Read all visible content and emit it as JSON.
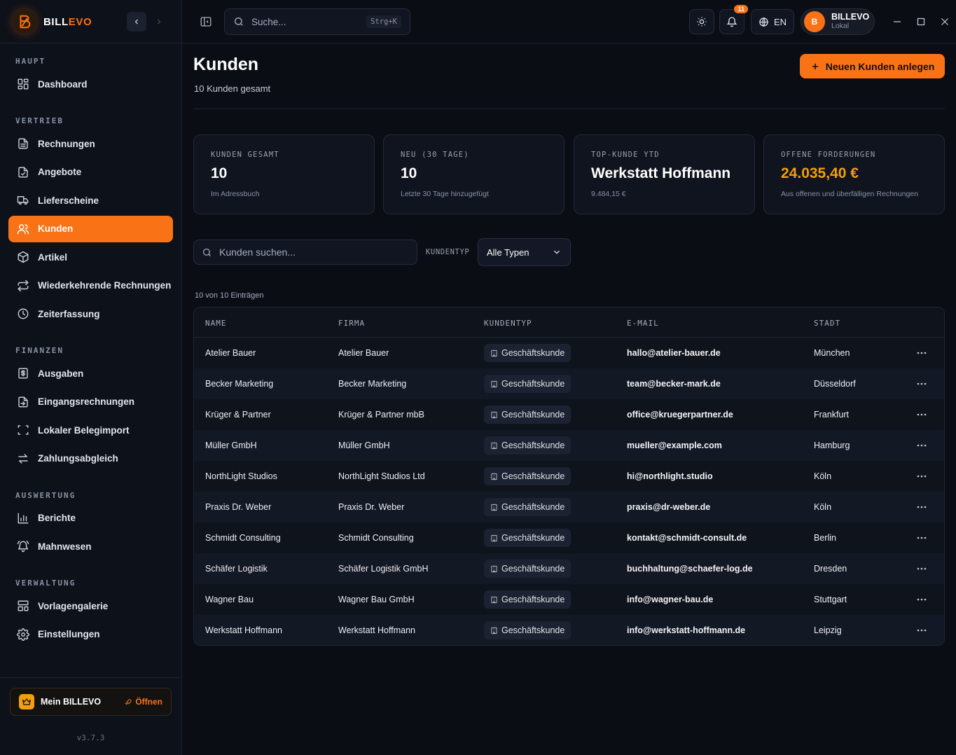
{
  "app": {
    "brand_prefix": "BILL",
    "brand_suffix": "EVO",
    "version": "v3.7.3",
    "accent_color": "#f97316"
  },
  "sidebar": {
    "sections": [
      {
        "label": "HAUPT",
        "items": [
          {
            "label": "Dashboard",
            "icon": "dashboard-icon"
          }
        ]
      },
      {
        "label": "VERTRIEB",
        "items": [
          {
            "label": "Rechnungen",
            "icon": "invoice-icon"
          },
          {
            "label": "Angebote",
            "icon": "quote-icon"
          },
          {
            "label": "Lieferscheine",
            "icon": "truck-icon"
          },
          {
            "label": "Kunden",
            "icon": "users-icon",
            "active": true
          },
          {
            "label": "Artikel",
            "icon": "package-icon"
          },
          {
            "label": "Wiederkehrende Rechnungen",
            "icon": "repeat-icon"
          },
          {
            "label": "Zeiterfassung",
            "icon": "clock-icon"
          }
        ]
      },
      {
        "label": "FINANZEN",
        "items": [
          {
            "label": "Ausgaben",
            "icon": "expense-icon"
          },
          {
            "label": "Eingangsrechnungen",
            "icon": "incoming-invoice-icon"
          },
          {
            "label": "Lokaler Belegimport",
            "icon": "scan-icon"
          },
          {
            "label": "Zahlungsabgleich",
            "icon": "swap-icon"
          }
        ]
      },
      {
        "label": "AUSWERTUNG",
        "items": [
          {
            "label": "Berichte",
            "icon": "bar-chart-icon"
          },
          {
            "label": "Mahnwesen",
            "icon": "bell-ring-icon"
          }
        ]
      },
      {
        "label": "VERWALTUNG",
        "items": [
          {
            "label": "Vorlagengalerie",
            "icon": "template-icon"
          },
          {
            "label": "Einstellungen",
            "icon": "gear-icon"
          }
        ]
      }
    ],
    "promo": {
      "label": "Mein BILLEVO",
      "action": "Öffnen"
    }
  },
  "topbar": {
    "search_placeholder": "Suche...",
    "search_shortcut": "Strg+K",
    "notifications_count": "11",
    "language": "EN",
    "user": {
      "initial": "B",
      "name": "BILLEVO",
      "subtitle": "Lokal"
    }
  },
  "page": {
    "title": "Kunden",
    "subtitle": "10 Kunden gesamt",
    "primary_action": "Neuen Kunden anlegen"
  },
  "stats": [
    {
      "label": "KUNDEN GESAMT",
      "value": "10",
      "hint": "Im Adressbuch"
    },
    {
      "label": "NEU (30 TAGE)",
      "value": "10",
      "hint": "Letzte 30 Tage hinzugefügt"
    },
    {
      "label": "TOP-KUNDE YTD",
      "value": "Werkstatt Hoffmann",
      "hint": "9.484,15 €"
    },
    {
      "label": "OFFENE FORDERUNGEN",
      "value": "24.035,40 €",
      "hint": "Aus offenen und überfälligen Rechnungen",
      "value_color": "#f59e0b"
    }
  ],
  "filters": {
    "search_placeholder": "Kunden suchen...",
    "type_label": "KUNDENTYP",
    "type_value": "Alle Typen"
  },
  "table": {
    "count_text": "10 von 10 Einträgen",
    "columns": [
      "NAME",
      "FIRMA",
      "KUNDENTYP",
      "E-MAIL",
      "STADT"
    ],
    "rows": [
      {
        "name": "Atelier Bauer",
        "company": "Atelier Bauer",
        "type": "Geschäftskunde",
        "email": "hallo@atelier-bauer.de",
        "city": "München"
      },
      {
        "name": "Becker Marketing",
        "company": "Becker Marketing",
        "type": "Geschäftskunde",
        "email": "team@becker-mark.de",
        "city": "Düsseldorf"
      },
      {
        "name": "Krüger & Partner",
        "company": "Krüger & Partner mbB",
        "type": "Geschäftskunde",
        "email": "office@kruegerpartner.de",
        "city": "Frankfurt"
      },
      {
        "name": "Müller GmbH",
        "company": "Müller GmbH",
        "type": "Geschäftskunde",
        "email": "mueller@example.com",
        "city": "Hamburg"
      },
      {
        "name": "NorthLight Studios",
        "company": "NorthLight Studios Ltd",
        "type": "Geschäftskunde",
        "email": "hi@northlight.studio",
        "city": "Köln"
      },
      {
        "name": "Praxis Dr. Weber",
        "company": "Praxis Dr. Weber",
        "type": "Geschäftskunde",
        "email": "praxis@dr-weber.de",
        "city": "Köln"
      },
      {
        "name": "Schmidt Consulting",
        "company": "Schmidt Consulting",
        "type": "Geschäftskunde",
        "email": "kontakt@schmidt-consult.de",
        "city": "Berlin"
      },
      {
        "name": "Schäfer Logistik",
        "company": "Schäfer Logistik GmbH",
        "type": "Geschäftskunde",
        "email": "buchhaltung@schaefer-log.de",
        "city": "Dresden"
      },
      {
        "name": "Wagner Bau",
        "company": "Wagner Bau GmbH",
        "type": "Geschäftskunde",
        "email": "info@wagner-bau.de",
        "city": "Stuttgart"
      },
      {
        "name": "Werkstatt Hoffmann",
        "company": "Werkstatt Hoffmann",
        "type": "Geschäftskunde",
        "email": "info@werkstatt-hoffmann.de",
        "city": "Leipzig"
      }
    ]
  }
}
